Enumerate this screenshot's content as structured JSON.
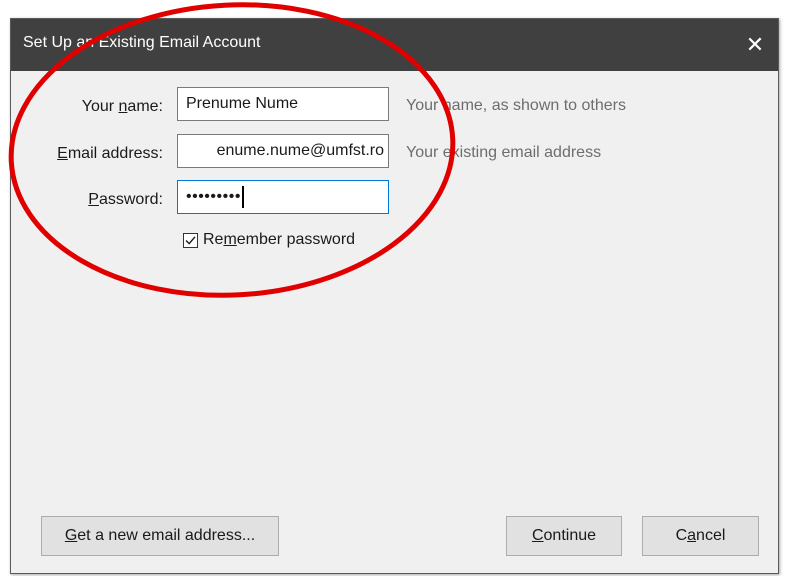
{
  "dialog": {
    "title": "Set Up an Existing Email Account",
    "close_symbol": "✕"
  },
  "form": {
    "name": {
      "label_pre": "Your ",
      "label_accel": "n",
      "label_post": "ame:",
      "value": "Prenume Nume",
      "hint": "Your name, as shown to others"
    },
    "email": {
      "label_pre": "",
      "label_accel": "E",
      "label_post": "mail address:",
      "value": "enume.nume@umfst.ro",
      "hint": "Your existing email address"
    },
    "password": {
      "label_pre": "",
      "label_accel": "P",
      "label_post": "assword:",
      "value": "•••••••••"
    },
    "remember": {
      "label_pre": "Re",
      "label_accel": "m",
      "label_post": "ember password",
      "checked": true
    }
  },
  "buttons": {
    "new_email": {
      "pre": "",
      "accel": "G",
      "post": "et a new email address..."
    },
    "continue": {
      "pre": "",
      "accel": "C",
      "post": "ontinue"
    },
    "cancel": {
      "pre": "C",
      "accel": "a",
      "post": "ncel"
    }
  },
  "colors": {
    "titlebar": "#404040",
    "focus_border": "#0078d7",
    "annotation": "#e00000"
  },
  "icons": {
    "close": "close-icon",
    "checkbox": "checkmark-icon"
  }
}
